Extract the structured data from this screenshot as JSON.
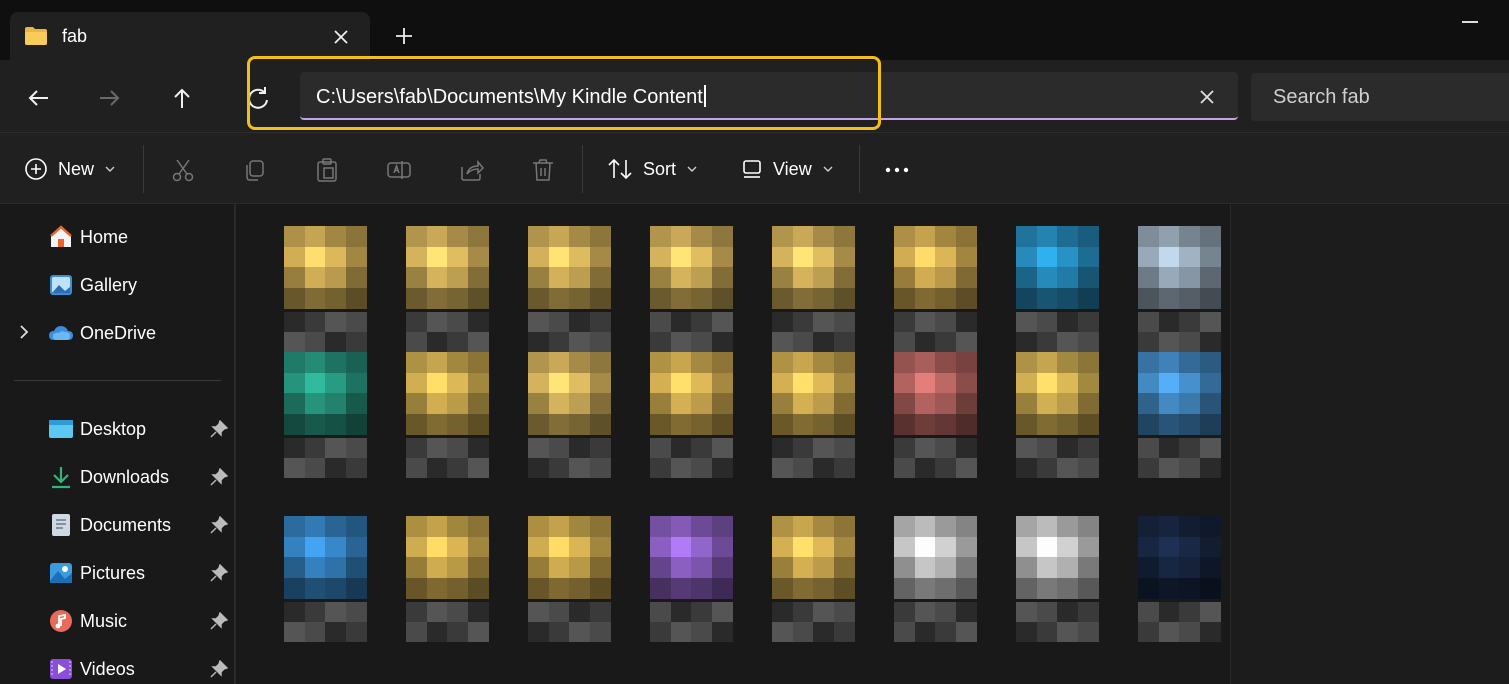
{
  "tab": {
    "title": "fab"
  },
  "address": {
    "path": "C:\\Users\\fab\\Documents\\My Kindle Content"
  },
  "search": {
    "placeholder": "Search fab"
  },
  "toolbar": {
    "new_label": "New",
    "sort_label": "Sort",
    "view_label": "View"
  },
  "sidebar": {
    "top_items": [
      {
        "label": "Home",
        "icon": "home-icon"
      },
      {
        "label": "Gallery",
        "icon": "gallery-icon"
      },
      {
        "label": "OneDrive",
        "icon": "onedrive-icon"
      }
    ],
    "pinned_items": [
      {
        "label": "Desktop",
        "icon": "desktop-icon"
      },
      {
        "label": "Downloads",
        "icon": "downloads-icon"
      },
      {
        "label": "Documents",
        "icon": "documents-icon"
      },
      {
        "label": "Pictures",
        "icon": "pictures-icon"
      },
      {
        "label": "Music",
        "icon": "music-icon"
      },
      {
        "label": "Videos",
        "icon": "videos-icon"
      }
    ]
  },
  "colors": {
    "accent_highlight": "#f4c016",
    "address_underline": "#c8a2e6"
  },
  "content": {
    "pixelated": true,
    "rows": [
      [
        "#e8c160",
        "#ecc766",
        "#eac564",
        "#ecc766",
        "#ecc766",
        "#e8bf5c",
        "#2a9ad0",
        "#a9bccd"
      ],
      [
        "#2aa38a",
        "#e8c25a",
        "#ecc766",
        "#ebc35c",
        "#ebc35c",
        "#c66e6a",
        "#e8c35c",
        "#4a98d8"
      ],
      [
        "#3a8fd3",
        "#e6bf58",
        "#e6bf58",
        "#9a6ad6",
        "#ebc35c",
        "#dcdcdc",
        "#dcdcdc",
        "#1a2a48"
      ]
    ]
  }
}
